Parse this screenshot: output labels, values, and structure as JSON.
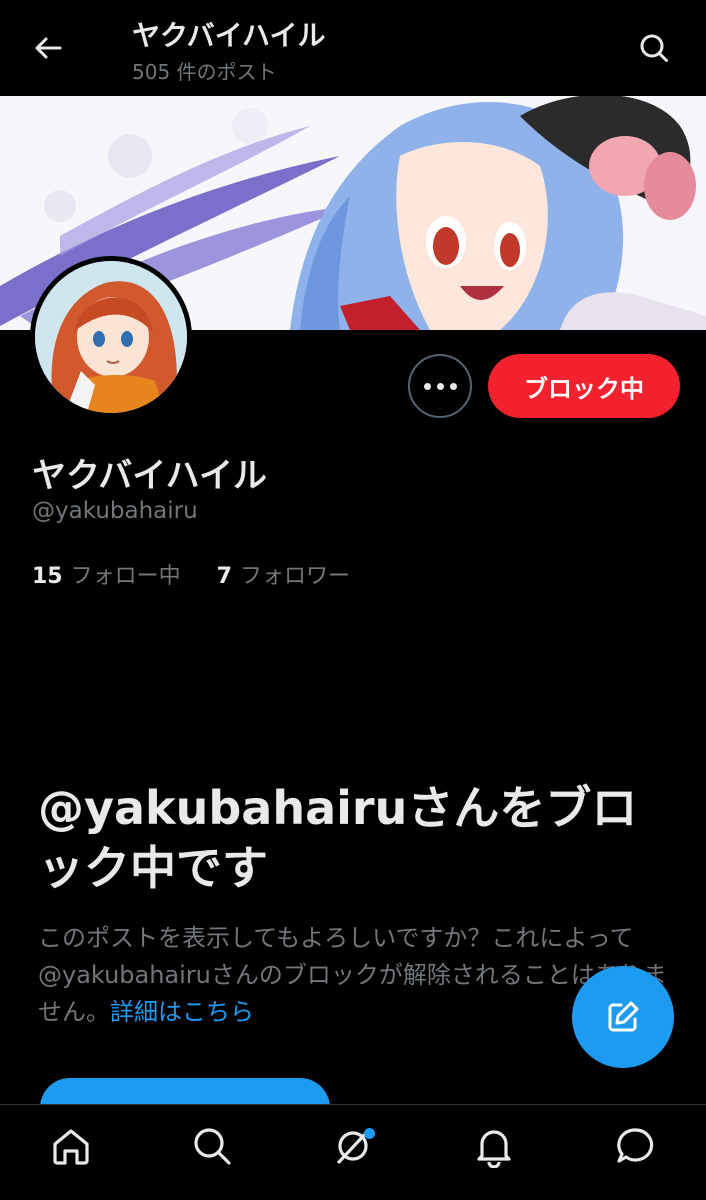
{
  "header": {
    "title": "ヤクバイハイル",
    "post_count": "505 件のポスト",
    "back_icon": "arrow-left-icon",
    "search_icon": "search-icon"
  },
  "profile": {
    "display_name": "ヤクバイハイル",
    "handle": "@yakubahairu",
    "following_count": "15",
    "following_label": "フォロー中",
    "followers_count": "7",
    "followers_label": "フォロワー"
  },
  "actions": {
    "more_icon": "more-dots-icon",
    "block_label": "ブロック中"
  },
  "blocked": {
    "title": "@yakubahairuさんをブロック中です",
    "description": "このポストを表示してもよろしいですか？これによって@yakubahairuさんのブロックが解除されることはありません。",
    "link": "詳細はこちら"
  },
  "nav": {
    "items": [
      "home-icon",
      "search-icon",
      "grok-icon",
      "notifications-bell-icon",
      "messages-icon"
    ]
  },
  "colors": {
    "background": "#000000",
    "block_red": "#f4212e",
    "accent_blue": "#1d9bf0",
    "secondary_text": "#71767b"
  }
}
